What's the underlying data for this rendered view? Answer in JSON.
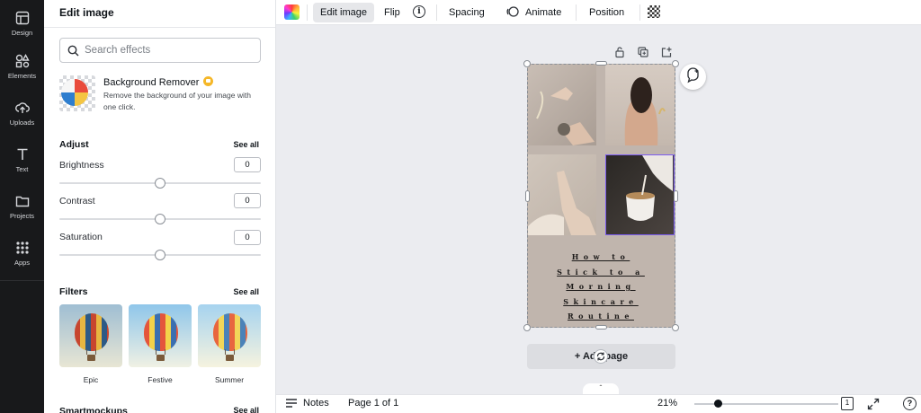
{
  "rail": {
    "items": [
      {
        "label": "Design",
        "icon": "design-icon"
      },
      {
        "label": "Elements",
        "icon": "elements-icon"
      },
      {
        "label": "Uploads",
        "icon": "uploads-icon"
      },
      {
        "label": "Text",
        "icon": "text-icon"
      },
      {
        "label": "Projects",
        "icon": "folder-icon"
      },
      {
        "label": "Apps",
        "icon": "apps-icon"
      }
    ]
  },
  "panel": {
    "title": "Edit image",
    "search_placeholder": "Search effects",
    "bg_remover": {
      "title": "Background Remover",
      "description": "Remove the background of your image with one click."
    },
    "adjust": {
      "heading": "Adjust",
      "see_all": "See all",
      "items": [
        {
          "label": "Brightness",
          "value": "0"
        },
        {
          "label": "Contrast",
          "value": "0"
        },
        {
          "label": "Saturation",
          "value": "0"
        }
      ]
    },
    "filters": {
      "heading": "Filters",
      "see_all": "See all",
      "items": [
        {
          "label": "Epic"
        },
        {
          "label": "Festive"
        },
        {
          "label": "Summer"
        }
      ]
    },
    "smartmockups": {
      "heading": "Smartmockups",
      "see_all": "See all"
    }
  },
  "toolbar": {
    "edit_image": "Edit image",
    "flip": "Flip",
    "info_glyph": "i",
    "spacing": "Spacing",
    "animate": "Animate",
    "position": "Position"
  },
  "canvas": {
    "title_lines": [
      "How to",
      "Stick to a",
      "Morning",
      "Skincare",
      "Routine"
    ],
    "add_page": "+ Add page",
    "background_color": "#c0b5ad",
    "selection_color": "#7b5cf0"
  },
  "bottombar": {
    "notes": "Notes",
    "page_info": "Page 1 of 1",
    "zoom": "21%",
    "pages_count": "1",
    "help_glyph": "?"
  }
}
